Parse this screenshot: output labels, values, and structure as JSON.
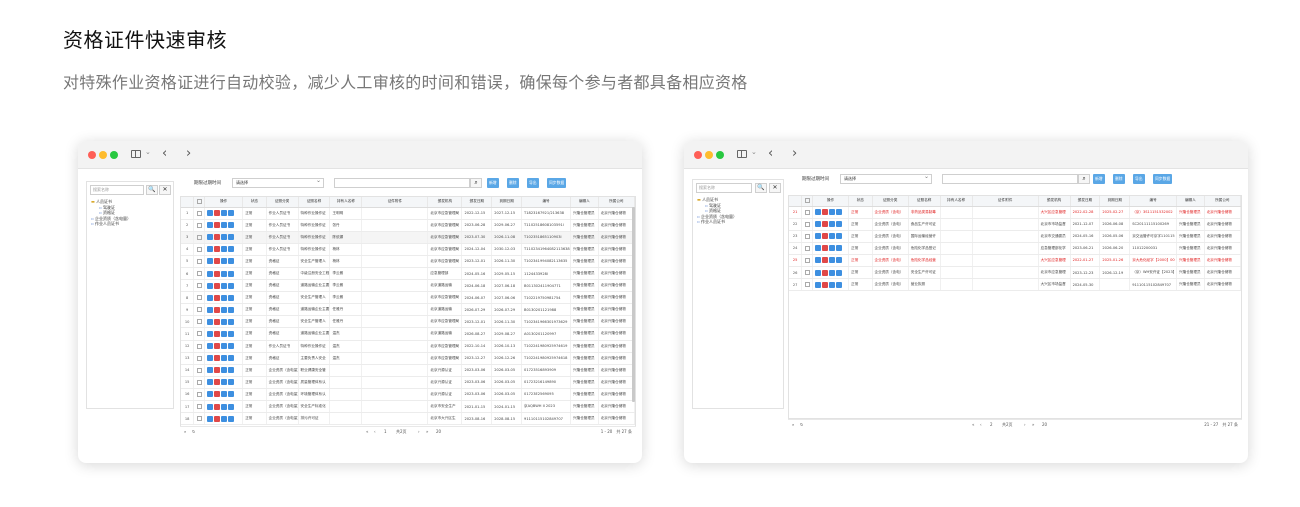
{
  "page": {
    "title": "资格证件快速审核",
    "subtitle": "对特殊作业资格证进行自动校验，减少人工审核的时间和错误，确保每个参与者都具备相应资格"
  },
  "common": {
    "search_placeholder": "搜索名称",
    "tree": {
      "root": "人员证书",
      "child1": "驾驶证",
      "child2": "资格证",
      "other1": "企业资质（含电量）",
      "other2": "作业人员证书"
    },
    "filter_label": "期限过期时间",
    "filter_value": "请选择",
    "buttons": {
      "add": "新增",
      "delete": "删除",
      "export": "导出",
      "sync": "同步数据"
    },
    "columns": {
      "ops": "操作",
      "status": "状态",
      "category": "证照分类",
      "name": "证照名称",
      "holder": "持有人名称",
      "attachment": "证件附件",
      "issuer": "颁发机构",
      "issue_date": "颁发日期",
      "expire_date": "到期日期",
      "number": "编号",
      "editor": "编辑人",
      "company": "所属公司"
    }
  },
  "left_window": {
    "rows": [
      {
        "n": "1",
        "status": "正常",
        "category": "作业人员证书",
        "name": "特种作业操作证",
        "holder": "王明明",
        "issuer": "北京市应急管理局",
        "issue": "2022-12-15",
        "expire": "2027-12-15",
        "number": "T1823167921/213638",
        "editor": "兴隆仓管理员",
        "company": "北京兴隆仓储物"
      },
      {
        "n": "2",
        "status": "正常",
        "category": "作业人员证书",
        "name": "特种作业操作证",
        "holder": "张丹",
        "issuer": "北京市应急管理局",
        "issue": "2023-06-28",
        "expire": "2029-06-27",
        "number": "T1102518608103591l",
        "editor": "兴隆仓管理员",
        "company": "北京兴隆仓储物"
      },
      {
        "n": "3",
        "status": "正常",
        "category": "作业人员证书",
        "name": "特种作业操作证",
        "holder": "陈依娜",
        "issuer": "北京市应急管理局",
        "issue": "2023-07-30",
        "expire": "2026-11-08",
        "number": "T102351865110903l",
        "editor": "兴隆仓管理员",
        "company": "北京兴隆仓储物"
      },
      {
        "n": "4",
        "status": "正常",
        "category": "作业人员证书",
        "name": "特种作业操作证",
        "holder": "杨林",
        "issuer": "北京市应急管理局",
        "issue": "2024-12-04",
        "expire": "2030-12-03",
        "number": "T1102341964082113638",
        "editor": "兴隆仓管理员",
        "company": "北京兴隆仓储物"
      },
      {
        "n": "5",
        "status": "正常",
        "category": "资格证",
        "name": "安全生产管理人",
        "holder": "杨林",
        "issuer": "北京市应急管理局",
        "issue": "2023-12-01",
        "expire": "2026-11-30",
        "number": "T102341994082113635",
        "editor": "兴隆仓管理员",
        "company": "北京兴隆仓储物"
      },
      {
        "n": "6",
        "status": "正常",
        "category": "资格证",
        "name": "中级注册安全工程",
        "holder": "李云朗",
        "issuer": "应急管理部",
        "issue": "2024-05-16",
        "expire": "2029-05-15",
        "number": "1124433928l",
        "editor": "兴隆仓管理员",
        "company": "北京兴隆仓储物"
      },
      {
        "n": "7",
        "status": "正常",
        "category": "资格证",
        "name": "道路运输企业主要",
        "holder": "李云朗",
        "issuer": "北京道路运输",
        "issue": "2024-06-18",
        "expire": "2027-06-18",
        "number": "B011302411904771",
        "editor": "兴隆仓管理员",
        "company": "北京兴隆仓储物"
      },
      {
        "n": "8",
        "status": "正常",
        "category": "资格证",
        "name": "安全生产管理人",
        "holder": "李云朗",
        "issuer": "北京市应急管理局",
        "issue": "2024-06-07",
        "expire": "2027-06-06",
        "number": "T102219750981754",
        "editor": "兴隆仓管理员",
        "company": "北京兴隆仓储物"
      },
      {
        "n": "9",
        "status": "正常",
        "category": "资格证",
        "name": "道路运输企业主要",
        "holder": "任雅丹",
        "issuer": "北京道路运输",
        "issue": "2026-07-29",
        "expire": "2026-07-29",
        "number": "B0130201121988",
        "editor": "兴隆仓管理员",
        "company": "北京兴隆仓储物"
      },
      {
        "n": "10",
        "status": "正常",
        "category": "资格证",
        "name": "安全生产管理人",
        "holder": "任雅丹",
        "issuer": "北京市应急管理局",
        "issue": "2023-12-01",
        "expire": "2026-11-30",
        "number": "T102341966301973629",
        "editor": "兴隆仓管理员",
        "company": "北京兴隆仓储物"
      },
      {
        "n": "11",
        "status": "正常",
        "category": "资格证",
        "name": "道路运输企业主要",
        "holder": "温杰",
        "issuer": "北京道路运输",
        "issue": "2026-08-27",
        "expire": "2029-08-27",
        "number": "A0130201120997",
        "editor": "兴隆仓管理员",
        "company": "北京兴隆仓储物"
      },
      {
        "n": "12",
        "status": "正常",
        "category": "作业人员证书",
        "name": "特种作业操作证",
        "holder": "温杰",
        "issuer": "北京市应急管理局",
        "issue": "2022-10-14",
        "expire": "2026-10-13",
        "number": "T102241980925974619",
        "editor": "兴隆仓管理员",
        "company": "北京兴隆仓储物"
      },
      {
        "n": "13",
        "status": "正常",
        "category": "资格证",
        "name": "主要负责人安全",
        "holder": "温杰",
        "issuer": "北京市应急管理局",
        "issue": "2023-12-27",
        "expire": "2026-12-26",
        "number": "T102241980925974618",
        "editor": "兴隆仓管理员",
        "company": "北京兴隆仓储物"
      },
      {
        "n": "14",
        "status": "正常",
        "category": "企业资质（含电量）",
        "name": "职业健康安全管",
        "holder": "",
        "issuer": "北京兴源认证",
        "issue": "2023-03-06",
        "expire": "2026-03-05",
        "number": "01723516893909",
        "editor": "兴隆仓管理员",
        "company": "北京兴隆仓储物"
      },
      {
        "n": "15",
        "status": "正常",
        "category": "企业资质（含电量）",
        "name": "质量管理体系认",
        "holder": "",
        "issuer": "北京兴源认证",
        "issue": "2023-03-06",
        "expire": "2026-03-05",
        "number": "01723216149890",
        "editor": "兴隆仓管理员",
        "company": "北京兴隆仓储物"
      },
      {
        "n": "16",
        "status": "正常",
        "category": "企业资质（含电量）",
        "name": "环境管理体系认",
        "holder": "",
        "issuer": "北京兴源认证",
        "issue": "2023-03-06",
        "expire": "2026-03-05",
        "number": "01723E2569095",
        "editor": "兴隆仓管理员",
        "company": "北京兴隆仓储物"
      },
      {
        "n": "17",
        "status": "正常",
        "category": "企业资质（含电量）",
        "name": "安全生产标准化",
        "holder": "",
        "issuer": "北京市安全生产",
        "issue": "2021-01-15",
        "expire": "2024-01-15",
        "number": "京AQBWH II 2023",
        "editor": "兴隆仓管理员",
        "company": "北京兴隆仓储物"
      },
      {
        "n": "18",
        "status": "正常",
        "category": "企业资质（含电量）",
        "name": "排污许可证",
        "holder": "",
        "issuer": "北京市大兴区生",
        "issue": "2023-08-16",
        "expire": "2028-08-15",
        "number": "91110115102849707",
        "editor": "兴隆仓管理员",
        "company": "北京兴隆仓储物"
      }
    ],
    "pager": {
      "page_input": "1",
      "page_total": "共2页",
      "page_size": "20",
      "info": "1 - 20　共 27 条"
    }
  },
  "right_window": {
    "rows": [
      {
        "n": "21",
        "status": "正常",
        "category": "企业资质（含电）",
        "name": "非药品类易制毒",
        "holder": "",
        "issuer": "大兴区应急管理",
        "issue": "2022-02-28",
        "expire": "2025-02-27",
        "number": "（京）3S11151532002",
        "editor": "兴隆仓管理员",
        "company": "北京兴隆仓储物",
        "red": true
      },
      {
        "n": "22",
        "status": "正常",
        "category": "企业资质（含电）",
        "name": "食品生产许可证",
        "holder": "",
        "issuer": "北京市市场监督",
        "issue": "2021-12-07",
        "expire": "2026-06-08",
        "number": "SC20111115100269",
        "editor": "兴隆仓管理员",
        "company": "北京兴隆仓储物",
        "red": false
      },
      {
        "n": "23",
        "status": "正常",
        "category": "企业资质（含电）",
        "name": "国际运输经营许",
        "holder": "",
        "issuer": "北京市交通委员",
        "issue": "2024-05-16",
        "expire": "2026-05-06",
        "number": "京交运管许可京字110115",
        "editor": "兴隆仓管理员",
        "company": "北京兴隆仓储物",
        "red": false
      },
      {
        "n": "24",
        "status": "正常",
        "category": "企业资质（含电）",
        "name": "危险化学品登记",
        "holder": "",
        "issuer": "应急管理部化学",
        "issue": "2023-06-21",
        "expire": "2026-06-20",
        "number": "11012200031",
        "editor": "兴隆仓管理员",
        "company": "北京兴隆仓储物",
        "red": false
      },
      {
        "n": "25",
        "status": "正常",
        "category": "企业资质（含电）",
        "name": "危险化学品经营",
        "holder": "",
        "issuer": "大兴区应急管理",
        "issue": "2022-01-27",
        "expire": "2025-01-26",
        "number": "京大危化经字【2000】00",
        "editor": "兴隆仓管理员",
        "company": "北京兴隆仓储物",
        "red": true
      },
      {
        "n": "26",
        "status": "正常",
        "category": "企业资质（含电）",
        "name": "安全生产许可证",
        "holder": "",
        "issuer": "北京市应急管理",
        "issue": "2023-12-23",
        "expire": "2026-12-19",
        "number": "（京）WH安许证【2023】",
        "editor": "兴隆仓管理员",
        "company": "北京兴隆仓储物",
        "red": false
      },
      {
        "n": "27",
        "status": "正常",
        "category": "企业资质（含电）",
        "name": "营业执照",
        "holder": "",
        "issuer": "大兴区市场监督",
        "issue": "2024-05-30",
        "expire": "",
        "number": "91110115102849707",
        "editor": "兴隆仓管理员",
        "company": "北京兴隆仓储物",
        "red": false
      }
    ],
    "pager": {
      "page_input": "2",
      "page_total": "共2页",
      "page_size": "20",
      "info": "21 - 27　共 27 条"
    }
  }
}
